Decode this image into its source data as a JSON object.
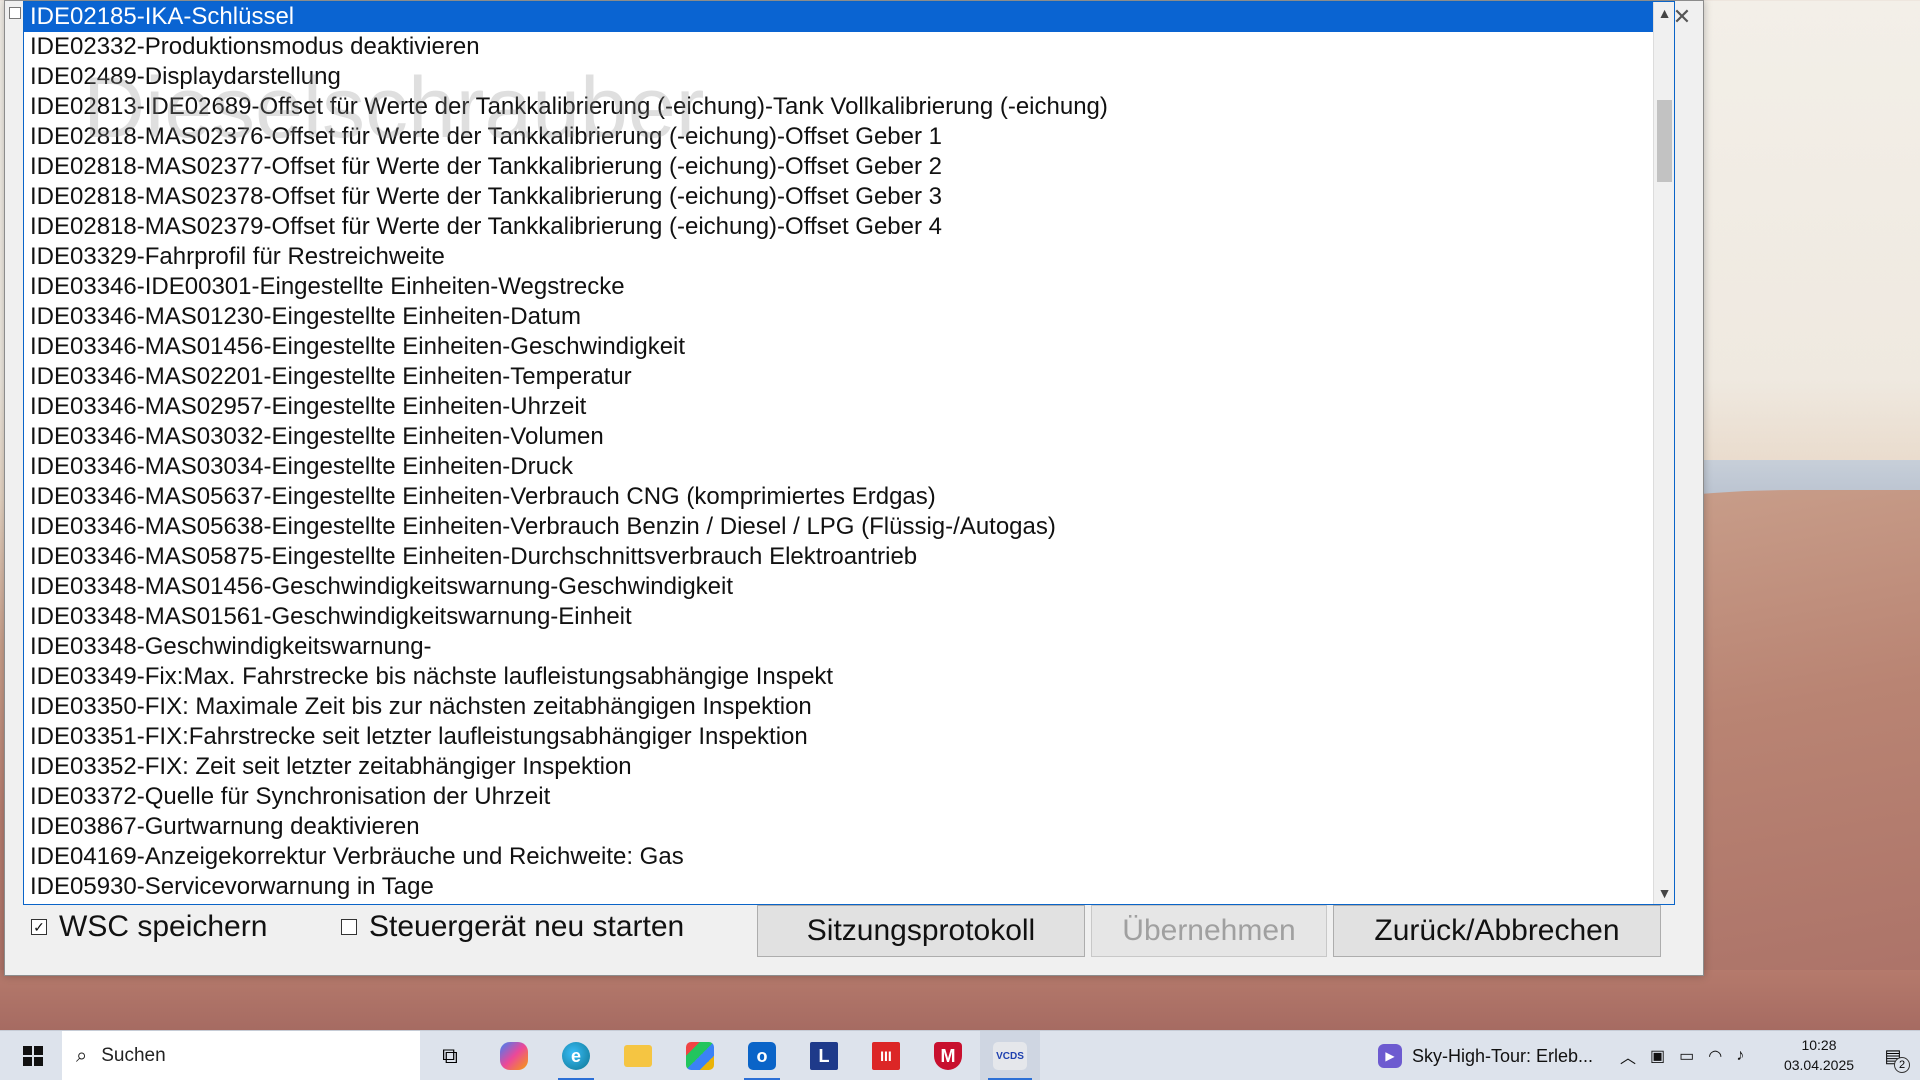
{
  "list": {
    "items": [
      "IDE02185-IKA-Schlüssel",
      "IDE02332-Produktionsmodus deaktivieren",
      "IDE02489-Displaydarstellung",
      "IDE02813-IDE02689-Offset für Werte der Tankkalibrierung (-eichung)-Tank Vollkalibrierung (-eichung)",
      "IDE02818-MAS02376-Offset für Werte der Tankkalibrierung (-eichung)-Offset Geber 1",
      "IDE02818-MAS02377-Offset für Werte der Tankkalibrierung (-eichung)-Offset Geber 2",
      "IDE02818-MAS02378-Offset für Werte der Tankkalibrierung (-eichung)-Offset Geber 3",
      "IDE02818-MAS02379-Offset für Werte der Tankkalibrierung (-eichung)-Offset Geber 4",
      "IDE03329-Fahrprofil für Restreichweite",
      "IDE03346-IDE00301-Eingestellte Einheiten-Wegstrecke",
      "IDE03346-MAS01230-Eingestellte Einheiten-Datum",
      "IDE03346-MAS01456-Eingestellte Einheiten-Geschwindigkeit",
      "IDE03346-MAS02201-Eingestellte Einheiten-Temperatur",
      "IDE03346-MAS02957-Eingestellte Einheiten-Uhrzeit",
      "IDE03346-MAS03032-Eingestellte Einheiten-Volumen",
      "IDE03346-MAS03034-Eingestellte Einheiten-Druck",
      "IDE03346-MAS05637-Eingestellte Einheiten-Verbrauch CNG (komprimiertes Erdgas)",
      "IDE03346-MAS05638-Eingestellte Einheiten-Verbrauch Benzin / Diesel / LPG (Flüssig-/Autogas)",
      "IDE03346-MAS05875-Eingestellte Einheiten-Durchschnittsverbrauch Elektroantrieb",
      "IDE03348-MAS01456-Geschwindigkeitswarnung-Geschwindigkeit",
      "IDE03348-MAS01561-Geschwindigkeitswarnung-Einheit",
      "IDE03348-Geschwindigkeitswarnung-",
      "IDE03349-Fix:Max. Fahrstrecke bis nächste laufleistungsabhängige Inspekt",
      "IDE03350-FIX: Maximale Zeit bis zur nächsten zeitabhängigen Inspektion",
      "IDE03351-FIX:Fahrstrecke seit letzter laufleistungsabhängiger Inspektion",
      "IDE03352-FIX: Zeit seit letzter zeitabhängiger Inspektion",
      "IDE03372-Quelle für Synchronisation der Uhrzeit",
      "IDE03867-Gurtwarnung deaktivieren",
      "IDE04169-Anzeigekorrektur Verbräuche und Reichweite: Gas",
      "IDE05930-Servicevorwarnung in Tage"
    ],
    "selected_index": 0
  },
  "watermark": "Dieselschrauber",
  "options": {
    "wsc_label": "WSC speichern",
    "wsc_checked": true,
    "restart_label": "Steuergerät neu starten",
    "restart_checked": false
  },
  "buttons": {
    "log": "Sitzungsprotokoll",
    "apply": "Übernehmen",
    "back": "Zurück/Abbrechen"
  },
  "taskbar": {
    "search_placeholder": "Suchen",
    "media_title": "Sky-High-Tour: Erleb...",
    "time": "10:28",
    "date": "03.04.2025",
    "notification_count": "2",
    "app_icons": [
      "task-view",
      "copilot",
      "edge",
      "file-explorer",
      "store",
      "outlook",
      "L",
      "III",
      "M",
      "VCDS"
    ]
  },
  "colors": {
    "selection": "#0a64d2",
    "taskbar": "#dde3ec"
  }
}
